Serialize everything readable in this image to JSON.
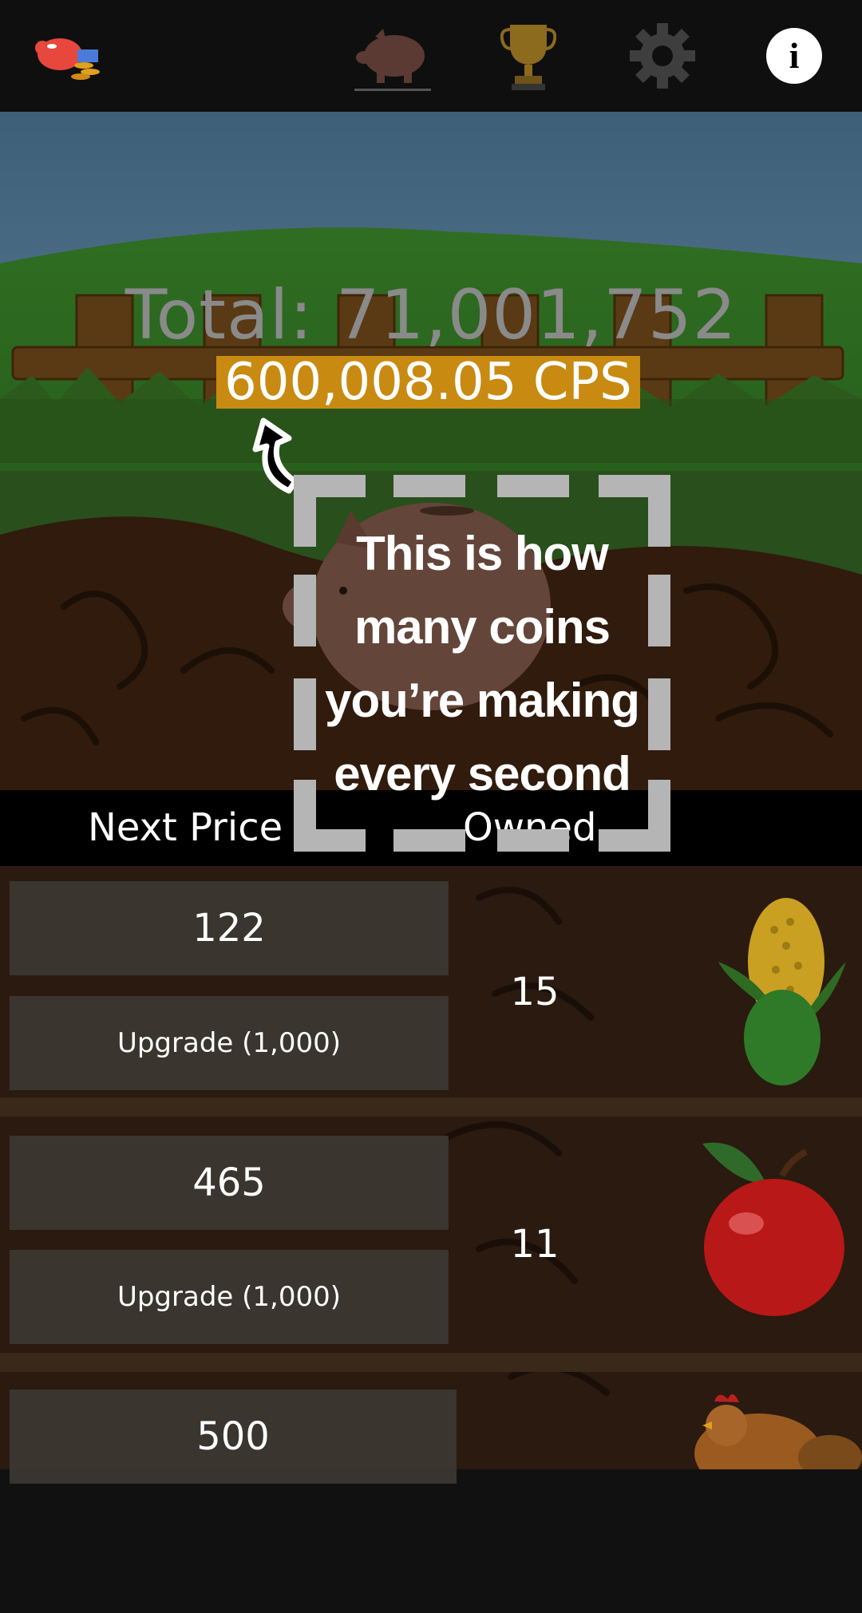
{
  "topbar": {
    "items": [
      {
        "name": "app-logo",
        "icon": "pig-coins-icon"
      },
      {
        "name": "tab-piggy",
        "icon": "piggy-bank-icon",
        "active": true
      },
      {
        "name": "tab-trophy",
        "icon": "trophy-icon"
      },
      {
        "name": "tab-settings",
        "icon": "gear-icon"
      },
      {
        "name": "info-button",
        "icon": "info-icon",
        "label": "i"
      }
    ]
  },
  "stats": {
    "total": "Total: 71,001,752",
    "cps": "600,008.05 CPS"
  },
  "tutorial": {
    "lines": [
      "This is how",
      "many coins",
      "you’re making",
      "every second"
    ]
  },
  "table_header": {
    "next_price": "Next Price",
    "owned": "Owned"
  },
  "items": [
    {
      "price": "122",
      "upgrade": "Upgrade (1,000)",
      "owned": "15",
      "icon": "corn-icon"
    },
    {
      "price": "465",
      "upgrade": "Upgrade (1,000)",
      "owned": "11",
      "icon": "apple-icon"
    },
    {
      "price": "500",
      "icon": "chicken-icon"
    }
  ],
  "colors": {
    "topbar": "#0f0f0f",
    "cps_highlight": "#c98a12",
    "callout_frame": "#b5b5b5",
    "button_bg": "#3c3732"
  }
}
